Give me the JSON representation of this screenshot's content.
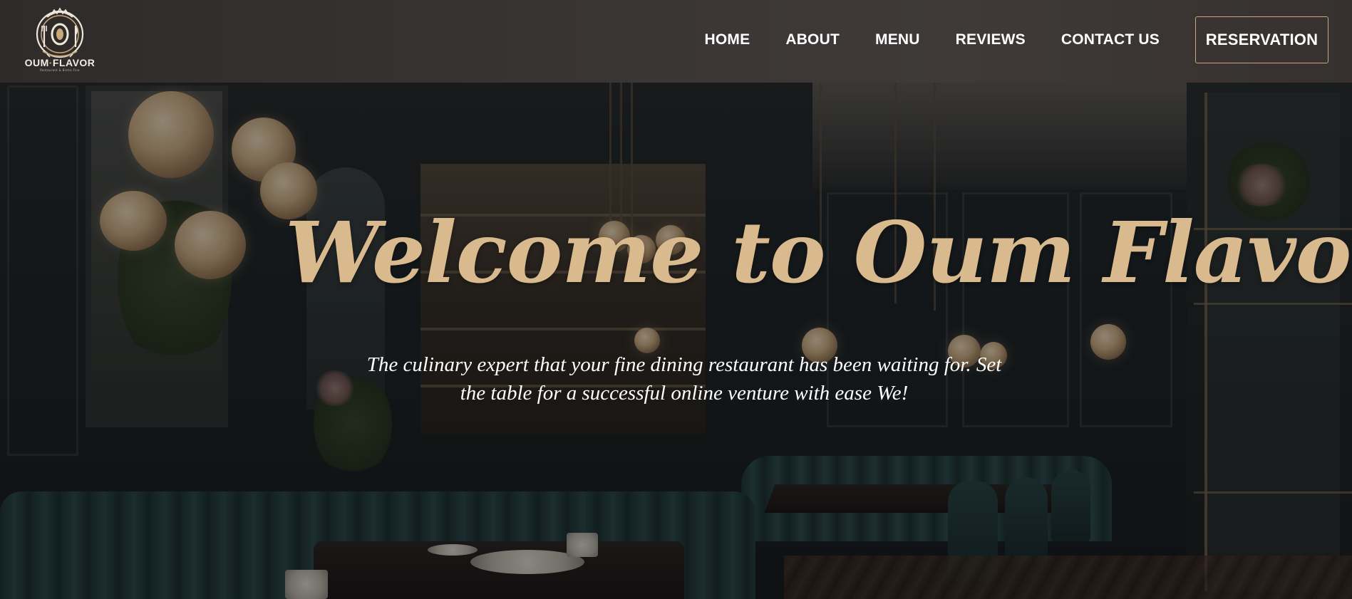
{
  "brand": {
    "name_left": "OUM",
    "name_sep": "·",
    "name_right": "FLAVOR",
    "tagline": "Restaurant & Bistro Fine",
    "accent_color": "#c9a77a"
  },
  "nav": {
    "items": [
      {
        "label": "HOME"
      },
      {
        "label": "ABOUT"
      },
      {
        "label": "MENU"
      },
      {
        "label": "REVIEWS"
      },
      {
        "label": "CONTACT US"
      }
    ],
    "cta_label": "RESERVATION"
  },
  "hero": {
    "title": "Welcome to Oum Flavor",
    "subtitle": "The culinary expert that your fine dining restaurant has been waiting for. Set the table for a successful online venture with ease We!",
    "title_color": "#d9b98e"
  },
  "icons": {
    "logo": "restaurant-emblem-icon"
  }
}
